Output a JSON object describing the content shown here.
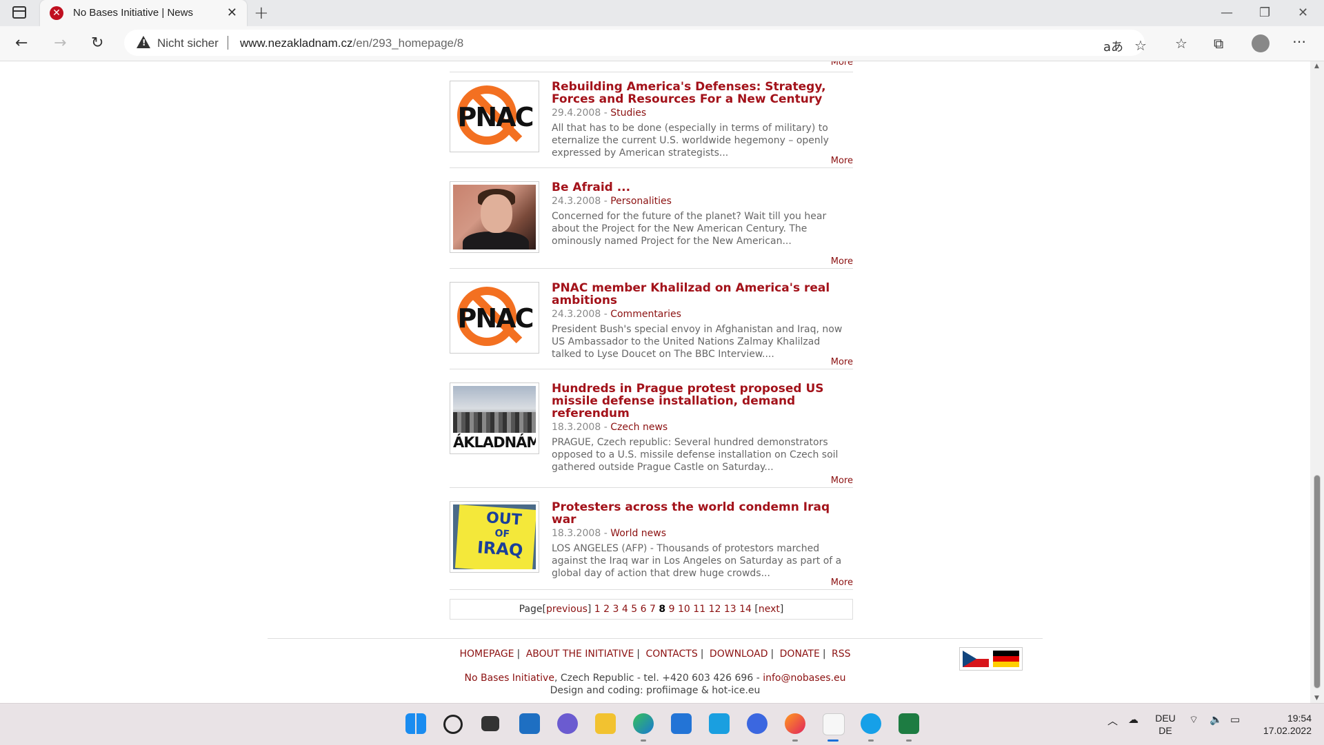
{
  "browser": {
    "tab_title": "No Bases Initiative | News",
    "security_label": "Nicht sicher",
    "url_domain": "www.nezakladnam.cz",
    "url_path": "/en/293_homepage/8"
  },
  "page": {
    "more_label": "More",
    "articles": [
      {
        "title": "Rebuilding America's Defenses: Strategy, Forces and Resources For a New Century",
        "date": "29.4.2008",
        "category": "Studies",
        "excerpt": "All that has to be done (especially in terms of military) to eternalize the current U.S. worldwide hegemony – openly expressed by American strategists...",
        "thumb": "pnac-logo",
        "thumb_text": "PNAC"
      },
      {
        "title": "Be Afraid ...",
        "date": "24.3.2008",
        "category": "Personalities",
        "excerpt": "Concerned for the future of the planet? Wait till you hear about the Project for the New American Century. The ominously named Project for the New American...",
        "thumb": "person-photo"
      },
      {
        "title": "PNAC member Khalilzad on America's real ambitions",
        "date": "24.3.2008",
        "category": "Commentaries",
        "excerpt": "President Bush's special envoy in Afghanistan and Iraq, now US Ambassador to the United Nations Zalmay Khalilzad talked to Lyse Doucet on The BBC Interview....",
        "thumb": "pnac-logo",
        "thumb_text": "PNAC"
      },
      {
        "title": "Hundreds in Prague protest proposed US missile defense installation, demand referendum",
        "date": "18.3.2008",
        "category": "Czech news",
        "excerpt": "PRAGUE, Czech republic: Several hundred demonstrators opposed to a U.S. missile defense installation on Czech soil gathered outside Prague Castle on Saturday...",
        "thumb": "protest-photo",
        "thumb_text": "ÁKLADNÁM"
      },
      {
        "title": "Protesters across the world condemn Iraq war",
        "date": "18.3.2008",
        "category": "World news",
        "excerpt": "LOS ANGELES (AFP) - Thousands of protestors marched against the Iraq war in Los Angeles on Saturday as part of a global day of action that drew huge crowds...",
        "thumb": "iraq-sign-photo",
        "thumb_text_1": "OUT",
        "thumb_text_2": "OF",
        "thumb_text_3": "IRAQ"
      }
    ],
    "pager": {
      "label": "Page",
      "previous": "previous",
      "next": "next",
      "pages": [
        "1",
        "2",
        "3",
        "4",
        "5",
        "6",
        "7",
        "8",
        "9",
        "10",
        "11",
        "12",
        "13",
        "14"
      ],
      "current": "8"
    },
    "footer": {
      "nav": [
        "HOMEPAGE",
        "ABOUT THE INITIATIVE",
        "CONTACTS",
        "DOWNLOAD",
        "DONATE",
        "RSS"
      ],
      "org": "No Bases Initiative",
      "address": ", Czech Republic - tel. +420 603 426 696 - ",
      "email": "info@nobases.eu",
      "credits": "Design and coding: profiimage & hot-ice.eu"
    }
  },
  "taskbar": {
    "lang_1": "DEU",
    "lang_2": "DE",
    "time": "19:54",
    "date": "17.02.2022"
  }
}
